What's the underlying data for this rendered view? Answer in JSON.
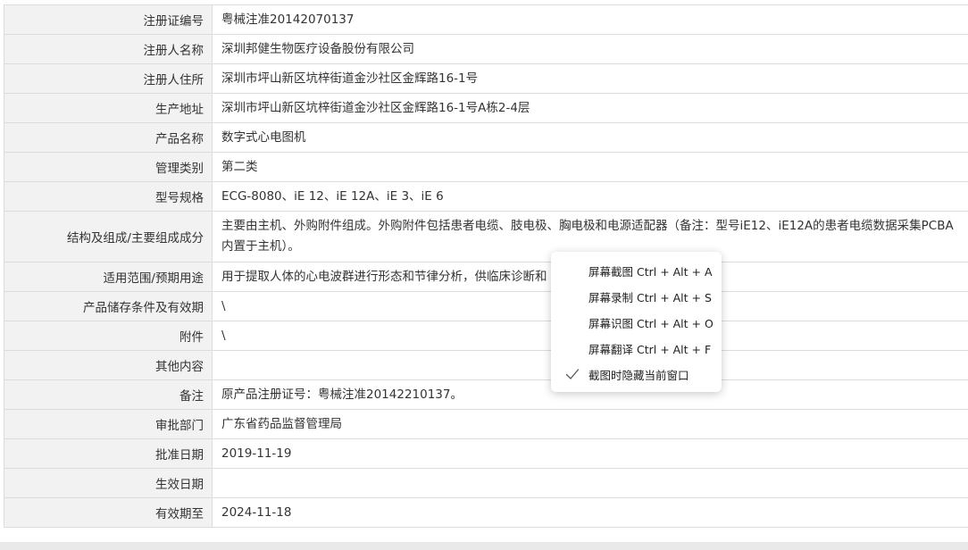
{
  "registration_table": {
    "rows": [
      {
        "label": "注册证编号",
        "value": "粤械注准20142070137"
      },
      {
        "label": "注册人名称",
        "value": "深圳邦健生物医疗设备股份有限公司"
      },
      {
        "label": "注册人住所",
        "value": "深圳市坪山新区坑梓街道金沙社区金辉路16-1号"
      },
      {
        "label": "生产地址",
        "value": "深圳市坪山新区坑梓街道金沙社区金辉路16-1号A栋2-4层"
      },
      {
        "label": "产品名称",
        "value": "数字式心电图机"
      },
      {
        "label": "管理类别",
        "value": "第二类"
      },
      {
        "label": "型号规格",
        "value": "ECG-8080、iE 12、iE 12A、iE 3、iE 6"
      },
      {
        "label": "结构及组成/主要组成成分",
        "value": "主要由主机、外购附件组成。外购附件包括患者电缆、肢电极、胸电极和电源适配器（备注：型号iE12、iE12A的患者电缆数据采集PCBA内置于主机）。"
      },
      {
        "label": "适用范围/预期用途",
        "value": "用于提取人体的心电波群进行形态和节律分析，供临床诊断和"
      },
      {
        "label": "产品储存条件及有效期",
        "value": "\\"
      },
      {
        "label": "附件",
        "value": "\\"
      },
      {
        "label": "其他内容",
        "value": ""
      },
      {
        "label": "备注",
        "value": "原产品注册证号：粤械注准20142210137。"
      },
      {
        "label": "审批部门",
        "value": "广东省药品监督管理局"
      },
      {
        "label": "批准日期",
        "value": "2019-11-19"
      },
      {
        "label": "生效日期",
        "value": ""
      },
      {
        "label": "有效期至",
        "value": "2024-11-18"
      }
    ]
  },
  "context_menu": {
    "items": [
      {
        "label": "屏幕截图 Ctrl + Alt + A",
        "checked": false
      },
      {
        "label": "屏幕录制 Ctrl + Alt + S",
        "checked": false
      },
      {
        "label": "屏幕识图 Ctrl + Alt + O",
        "checked": false
      },
      {
        "label": "屏幕翻译 Ctrl + Alt + F",
        "checked": false
      },
      {
        "label": "截图时隐藏当前窗口",
        "checked": true
      }
    ],
    "check_icon": "checkmark-icon"
  },
  "colors": {
    "label_bg": "#f2f2f2",
    "border": "#dcdcdc",
    "text": "#333333"
  }
}
